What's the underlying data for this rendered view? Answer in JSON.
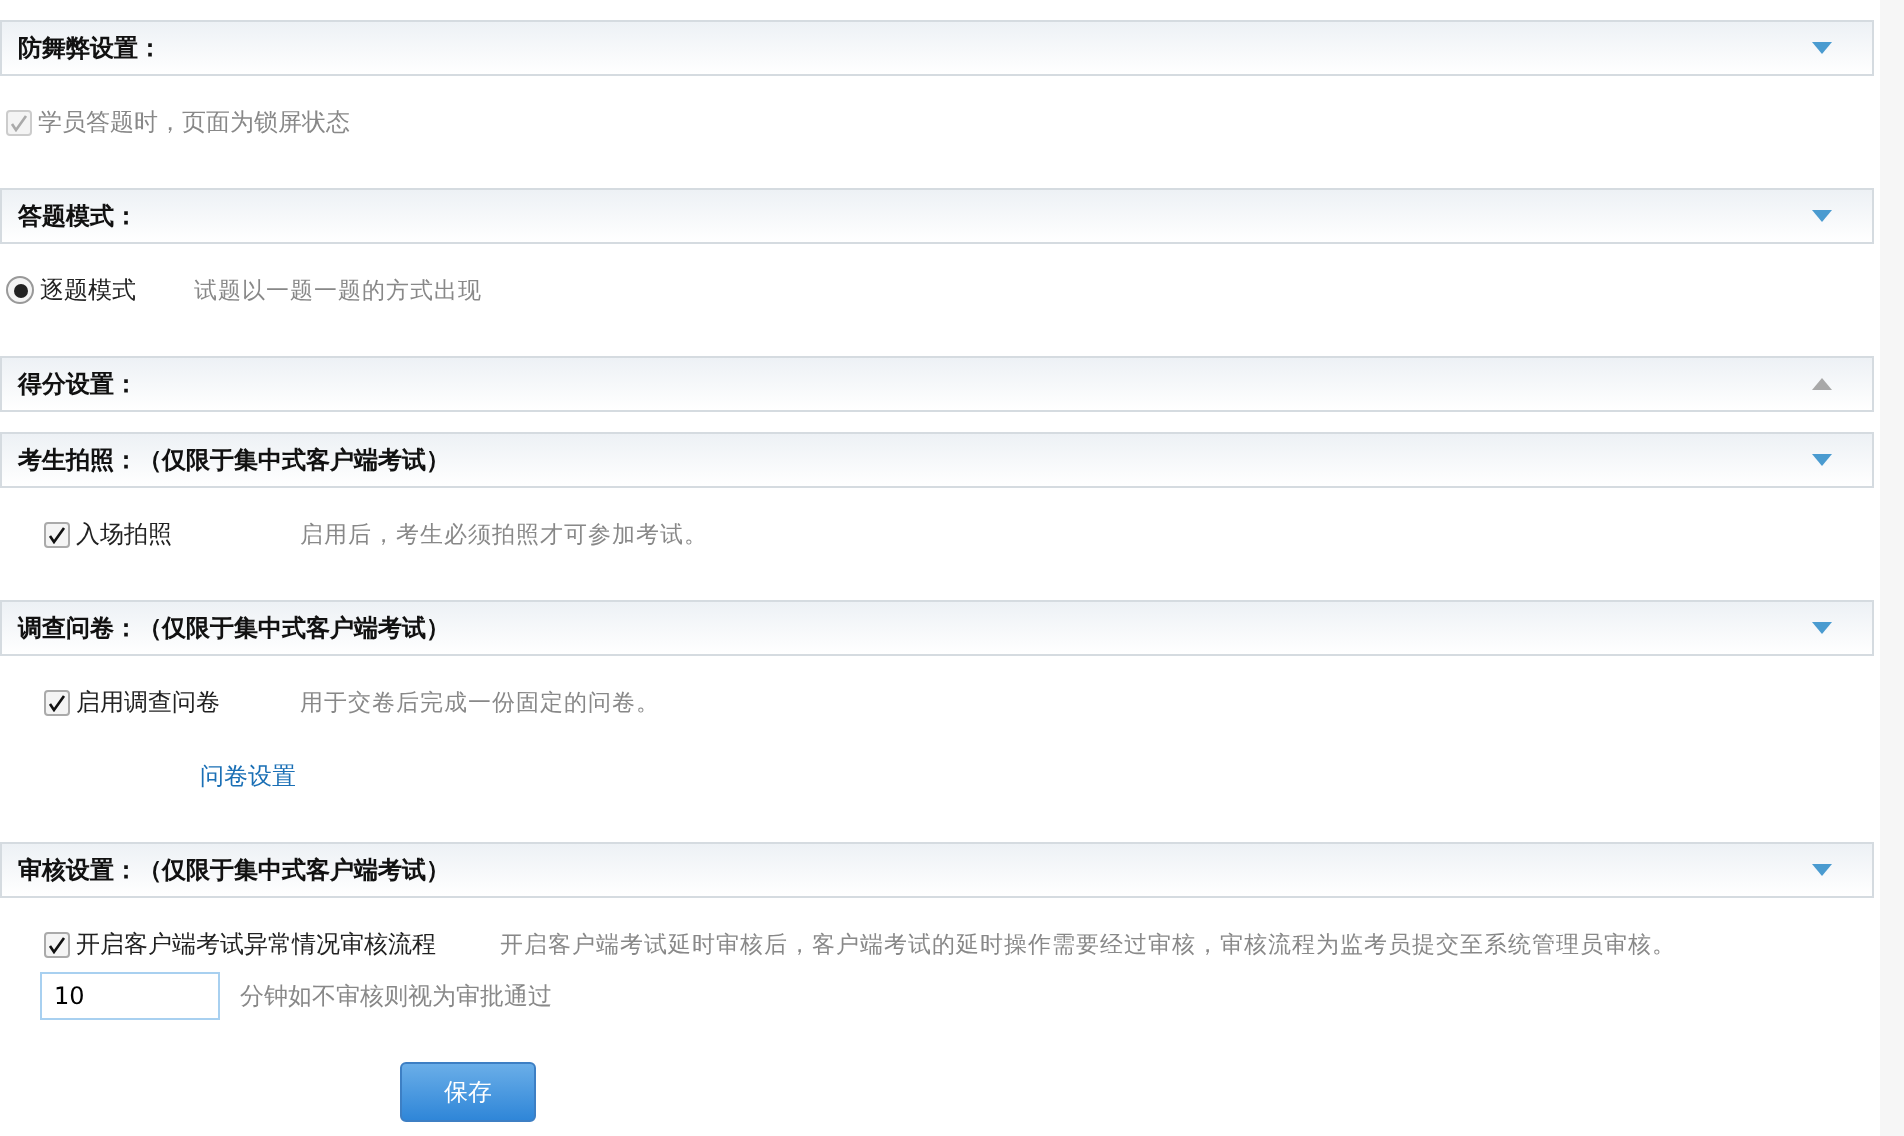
{
  "sections": [
    {
      "title": "防舞弊设置：",
      "expanded": true,
      "items": [
        {
          "kind": "checkbox",
          "label": "学员答题时，页面为锁屏状态",
          "checked": true,
          "disabled": true
        }
      ]
    },
    {
      "title": "答题模式：",
      "expanded": true,
      "items": [
        {
          "kind": "radio",
          "label": "逐题模式",
          "selected": true,
          "description": "试题以一题一题的方式出现"
        }
      ]
    },
    {
      "title": "得分设置：",
      "expanded": false
    },
    {
      "title": "考生拍照：（仅限于集中式客户端考试）",
      "expanded": true,
      "items": [
        {
          "kind": "checkbox",
          "label": "入场拍照",
          "checked": true,
          "disabled": false,
          "description": "启用后，考生必须拍照才可参加考试。"
        }
      ]
    },
    {
      "title": "调查问卷：（仅限于集中式客户端考试）",
      "expanded": true,
      "items": [
        {
          "kind": "checkbox",
          "label": "启用调查问卷",
          "checked": true,
          "disabled": false,
          "description": "用于交卷后完成一份固定的问卷。"
        },
        {
          "kind": "link",
          "label": "问卷设置"
        }
      ]
    },
    {
      "title": "审核设置：（仅限于集中式客户端考试）",
      "expanded": true,
      "items": [
        {
          "kind": "checkbox",
          "label": "开启客户端考试异常情况审核流程",
          "checked": true,
          "disabled": false,
          "description": "开启客户端考试延时审核后，客户端考试的延时操作需要经过审核，审核流程为监考员提交至系统管理员审核。"
        },
        {
          "kind": "number",
          "value": "10",
          "suffix": "分钟如不审核则视为审批通过"
        }
      ]
    }
  ],
  "save_button": "保存"
}
